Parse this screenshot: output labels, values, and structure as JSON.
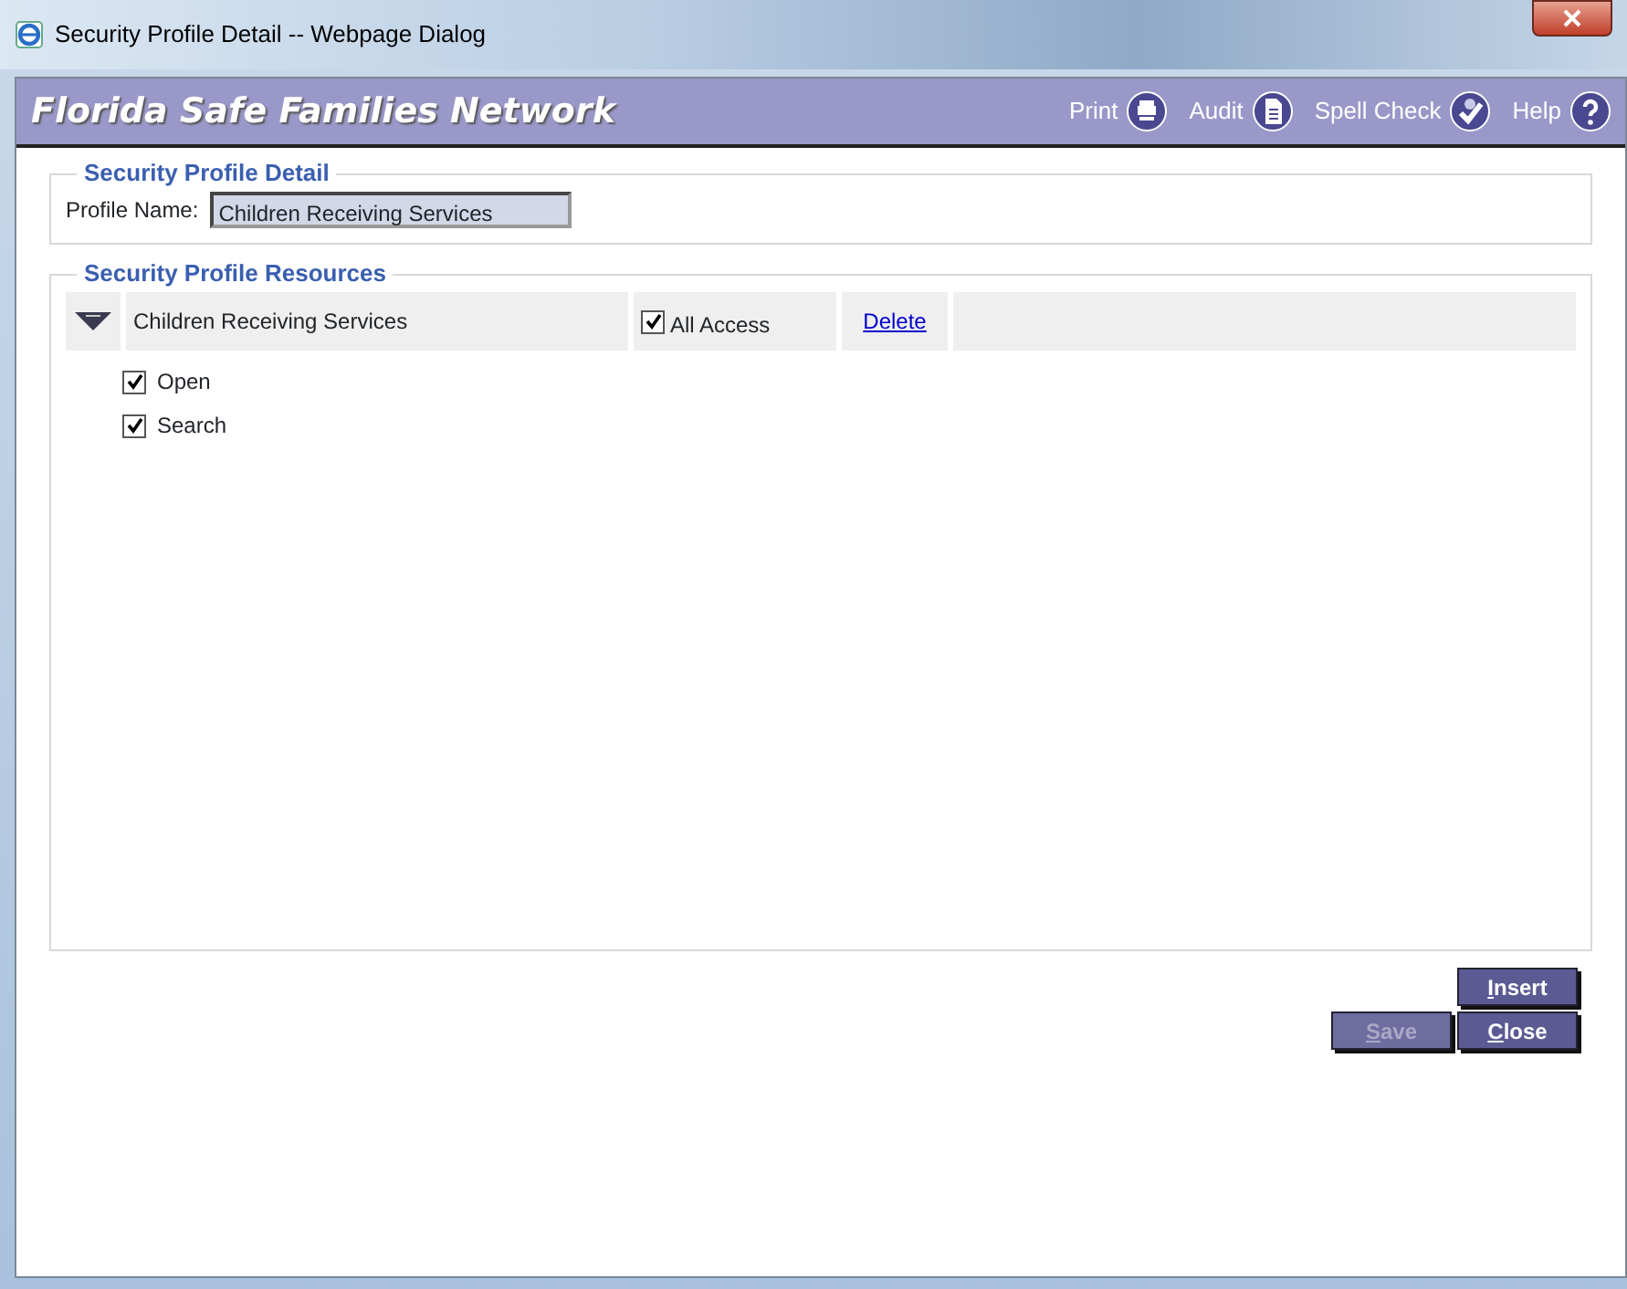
{
  "window": {
    "title": "Security Profile Detail -- Webpage Dialog"
  },
  "header": {
    "title": "Florida Safe Families Network",
    "tools": [
      {
        "label": "Print",
        "kind": "print"
      },
      {
        "label": "Audit",
        "kind": "audit"
      },
      {
        "label": "Spell Check",
        "kind": "spell"
      },
      {
        "label": "Help",
        "kind": "help"
      }
    ]
  },
  "detail": {
    "legend": "Security Profile Detail",
    "profile_name_label": "Profile Name:",
    "profile_name": "Children Receiving Services"
  },
  "resources": {
    "legend": "Security Profile Resources",
    "name": "Children Receiving Services",
    "expanded": true,
    "all_access": {
      "label": "All Access",
      "checked": true
    },
    "delete": "Delete",
    "permissions": [
      {
        "label": "Open",
        "checked": true
      },
      {
        "label": "Search",
        "checked": true
      }
    ]
  },
  "buttons": [
    {
      "label": "Insert",
      "disabled": false
    },
    {
      "label": "Save",
      "disabled": true
    },
    {
      "label": "Close",
      "disabled": false
    }
  ]
}
